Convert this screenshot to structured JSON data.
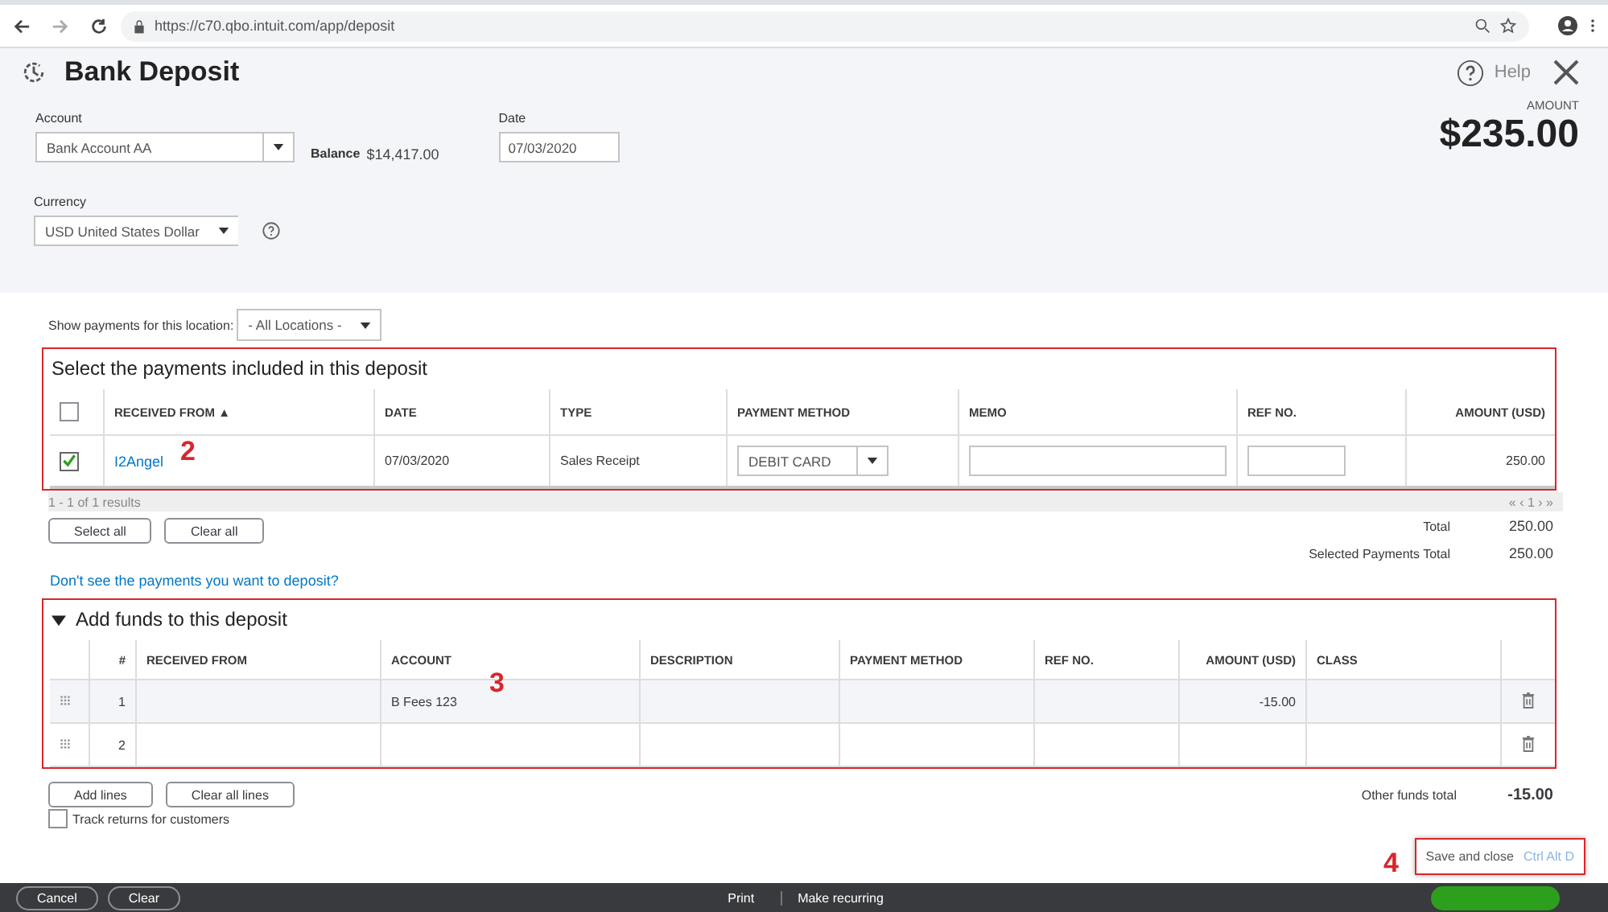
{
  "browser": {
    "url": "https://c70.qbo.intuit.com/app/deposit"
  },
  "header": {
    "title": "Bank Deposit",
    "help": "Help",
    "amount_label": "AMOUNT",
    "amount": "$235.00",
    "account": {
      "label": "Account",
      "value": "Bank Account AA"
    },
    "balance_label": "Balance",
    "balance": "$14,417.00",
    "date": {
      "label": "Date",
      "value": "07/03/2020"
    },
    "currency": {
      "label": "Currency",
      "value": "USD United States Dollar"
    }
  },
  "location_filter": {
    "label": "Show payments for this location:",
    "value": "- All Locations -"
  },
  "payments": {
    "title": "Select the payments included in this deposit",
    "annotation": "2",
    "all_checked": false,
    "columns": [
      {
        "label": "RECEIVED FROM",
        "sort": "▲"
      },
      {
        "label": "DATE"
      },
      {
        "label": "TYPE"
      },
      {
        "label": "PAYMENT METHOD"
      },
      {
        "label": "MEMO"
      },
      {
        "label": "REF NO."
      },
      {
        "label": "AMOUNT (USD)"
      }
    ],
    "rows": [
      {
        "checked": true,
        "received_from": "I2Angel",
        "date": "07/03/2020",
        "type": "Sales Receipt",
        "payment_method": "DEBIT CARD",
        "amount": "250.00"
      }
    ],
    "results": "1 - 1 of 1 results",
    "pager": "« ‹ 1 › »",
    "buttons": [
      "Select all",
      "Clear all"
    ],
    "totals": [
      {
        "label": "Total",
        "value": "250.00"
      },
      {
        "label": "Selected Payments Total",
        "value": "250.00"
      }
    ]
  },
  "help_link": "Don't see the payments you want to deposit?",
  "funds": {
    "title": "Add funds to this deposit",
    "expanded": true,
    "annotation": "3",
    "columns": [
      "#",
      "RECEIVED FROM",
      "ACCOUNT",
      "DESCRIPTION",
      "PAYMENT METHOD",
      "REF NO.",
      "AMOUNT (USD)",
      "CLASS"
    ],
    "rows": [
      {
        "number": "1",
        "account": "B Fees 123",
        "amount": "-15.00",
        "highlighted": true
      },
      {
        "number": "2",
        "highlighted": false
      }
    ],
    "buttons": [
      "Add lines",
      "Clear all lines"
    ],
    "total_label": "Other funds total",
    "total": "-15.00",
    "track_returns": {
      "label": "Track returns for customers",
      "checked": false
    }
  },
  "save_popup": {
    "label": "Save and close",
    "shortcut": "Ctrl Alt D",
    "annotation": "4"
  },
  "footer": {
    "buttons": [
      "Cancel",
      "Clear"
    ],
    "links": [
      "Print",
      "Make recurring"
    ]
  }
}
